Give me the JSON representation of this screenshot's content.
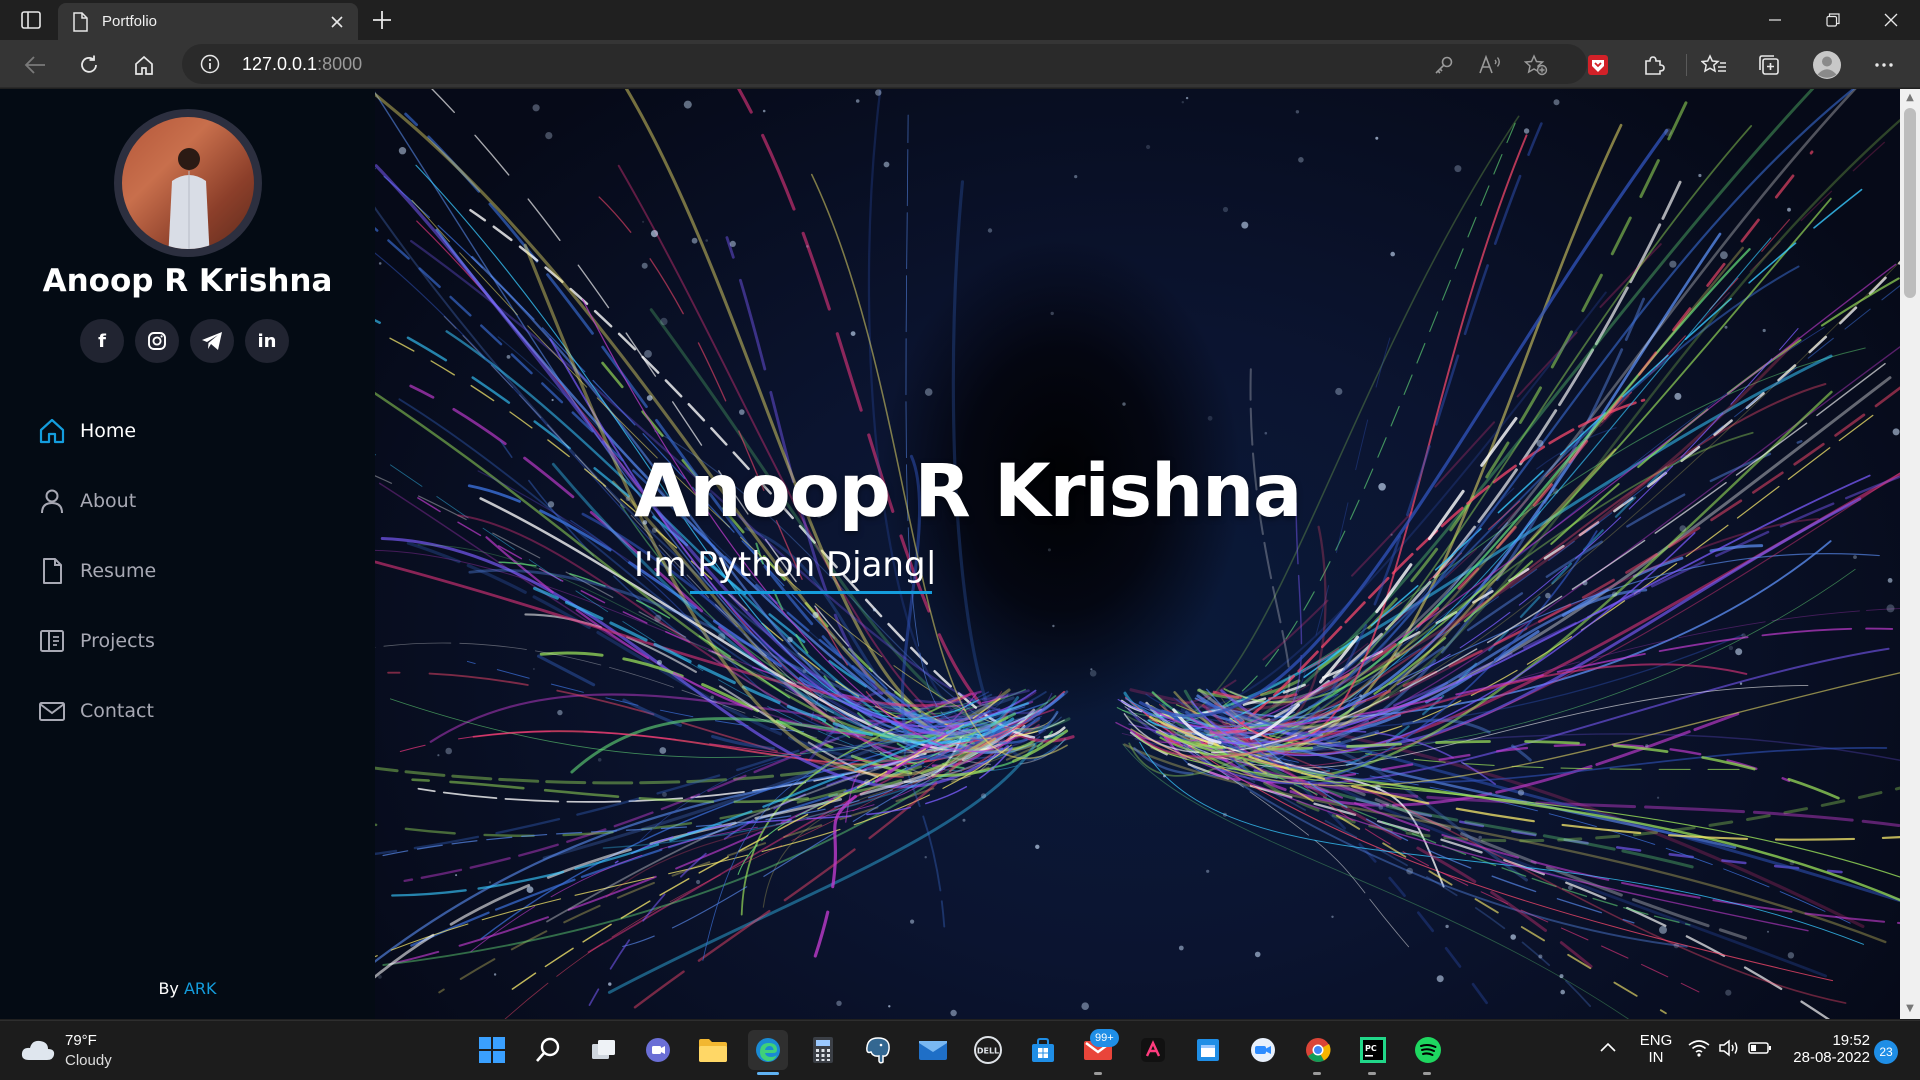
{
  "browser": {
    "tab_title": "Portfolio",
    "url_host": "127.0.0.1",
    "url_port": ":8000"
  },
  "sidebar": {
    "name": "Anoop R Krishna",
    "social": [
      {
        "label": "f",
        "icon": "facebook-icon"
      },
      {
        "label": "",
        "icon": "instagram-icon"
      },
      {
        "label": "",
        "icon": "telegram-icon"
      },
      {
        "label": "in",
        "icon": "linkedin-icon"
      }
    ],
    "nav": [
      {
        "label": "Home",
        "icon": "home-icon",
        "active": true
      },
      {
        "label": "About",
        "icon": "person-icon",
        "active": false
      },
      {
        "label": "Resume",
        "icon": "file-icon",
        "active": false
      },
      {
        "label": "Projects",
        "icon": "book-icon",
        "active": false
      },
      {
        "label": "Contact",
        "icon": "envelope-icon",
        "active": false
      }
    ],
    "credit_prefix": "By",
    "credit_link": "ARK",
    "accent_color": "#149ddd"
  },
  "hero": {
    "title": "Anoop R Krishna",
    "subtitle": "I'm Python Djang|"
  },
  "taskbar": {
    "weather_temp": "79°F",
    "weather_desc": "Cloudy",
    "mail_badge": "99+",
    "lang_line1": "ENG",
    "lang_line2": "IN",
    "time": "19:52",
    "date": "28-08-2022",
    "notification_count": "23"
  }
}
